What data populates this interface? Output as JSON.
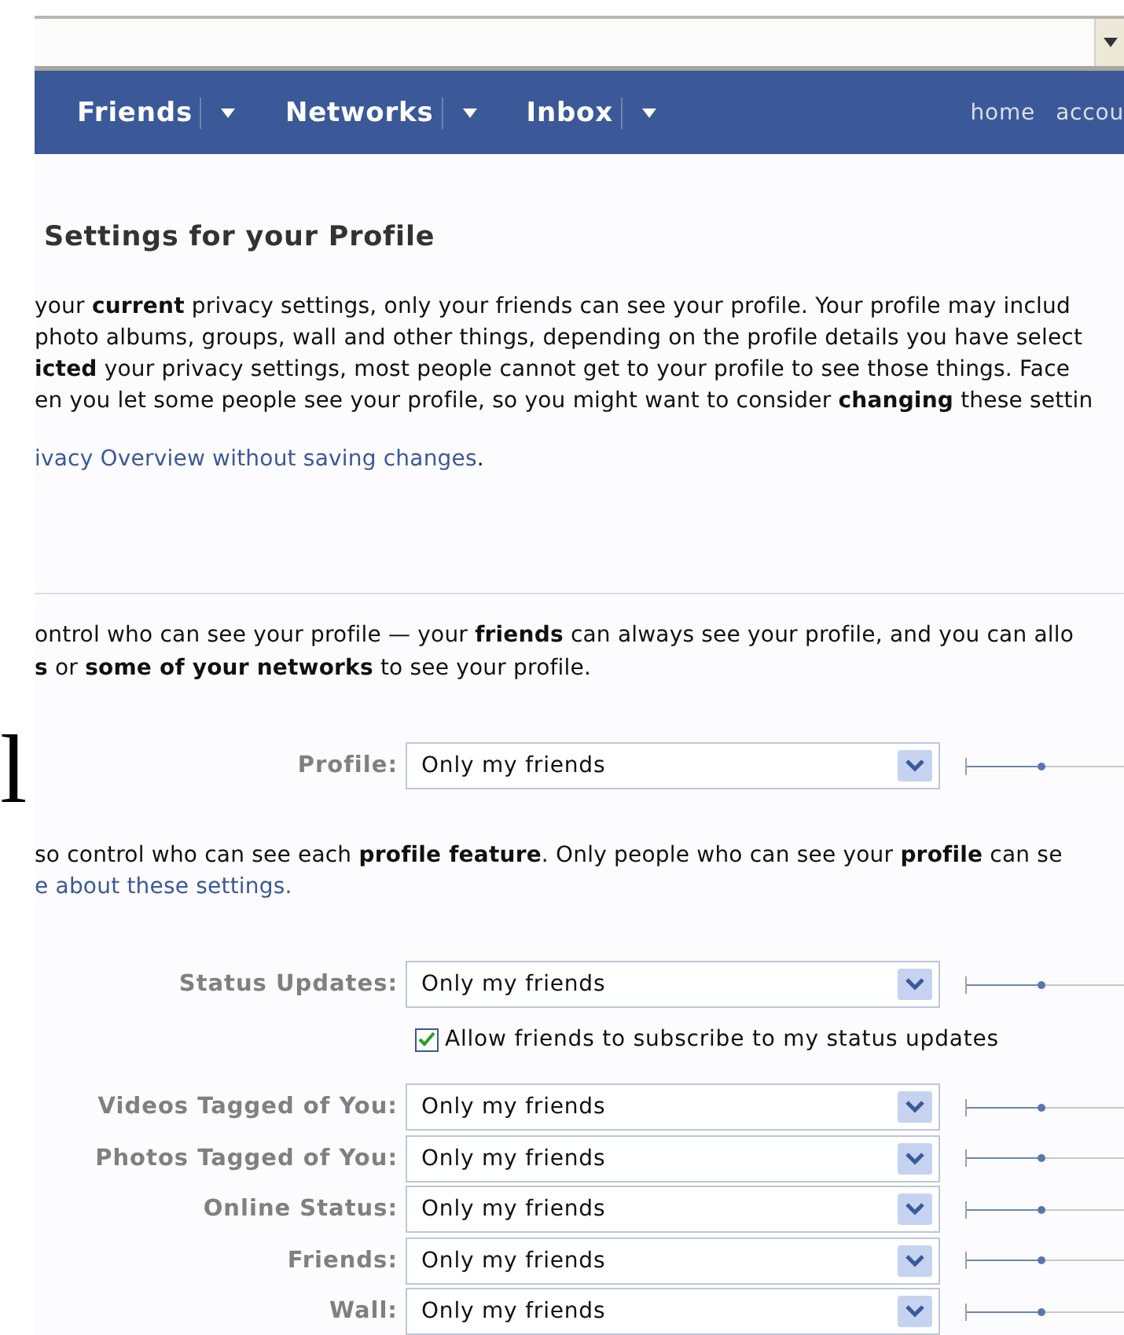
{
  "nav": {
    "items": [
      {
        "label": "Friends"
      },
      {
        "label": "Networks"
      },
      {
        "label": "Inbox"
      }
    ],
    "links": [
      "home",
      "accou"
    ]
  },
  "stray_glyph": "l",
  "title": "Settings for your Profile",
  "intro_lines": [
    "your **current** privacy settings, only your friends can see your profile. Your profile may includ",
    "photo albums, groups, wall and other things, depending on the profile details you have select",
    "**icted** your privacy settings, most people cannot get to your profile to see those things. Face",
    "en you let some people see your profile, so you might want to consider **changing** these settin"
  ],
  "intro_link": {
    "text": "ivacy Overview without saving changes",
    "after": "."
  },
  "profile_section": {
    "lines": [
      "ontrol who can see your profile — your **friends** can always see your profile, and you can allo",
      "**s** or **some of your networks** to see your profile."
    ],
    "rows": [
      {
        "label": "Profile:",
        "value": "Only my friends",
        "level": 0.47
      }
    ]
  },
  "feature_section": {
    "lines": [
      "so control who can see each **profile feature**. Only people who can see your **profile** can se"
    ],
    "link": "e about these settings.",
    "rows": [
      {
        "label": "Status Updates:",
        "value": "Only my friends",
        "level": 0.47,
        "checkbox": {
          "label": "Allow friends to subscribe to my status updates",
          "checked": true
        }
      },
      {
        "label": "Videos Tagged of You:",
        "value": "Only my friends",
        "level": 0.47
      },
      {
        "label": "Photos Tagged of You:",
        "value": "Only my friends",
        "level": 0.47
      },
      {
        "label": "Online Status:",
        "value": "Only my friends",
        "level": 0.47
      },
      {
        "label": "Friends:",
        "value": "Only my friends",
        "level": 0.47
      },
      {
        "label": "Wall:",
        "value": "Only my friends",
        "level": 0.47
      }
    ]
  }
}
